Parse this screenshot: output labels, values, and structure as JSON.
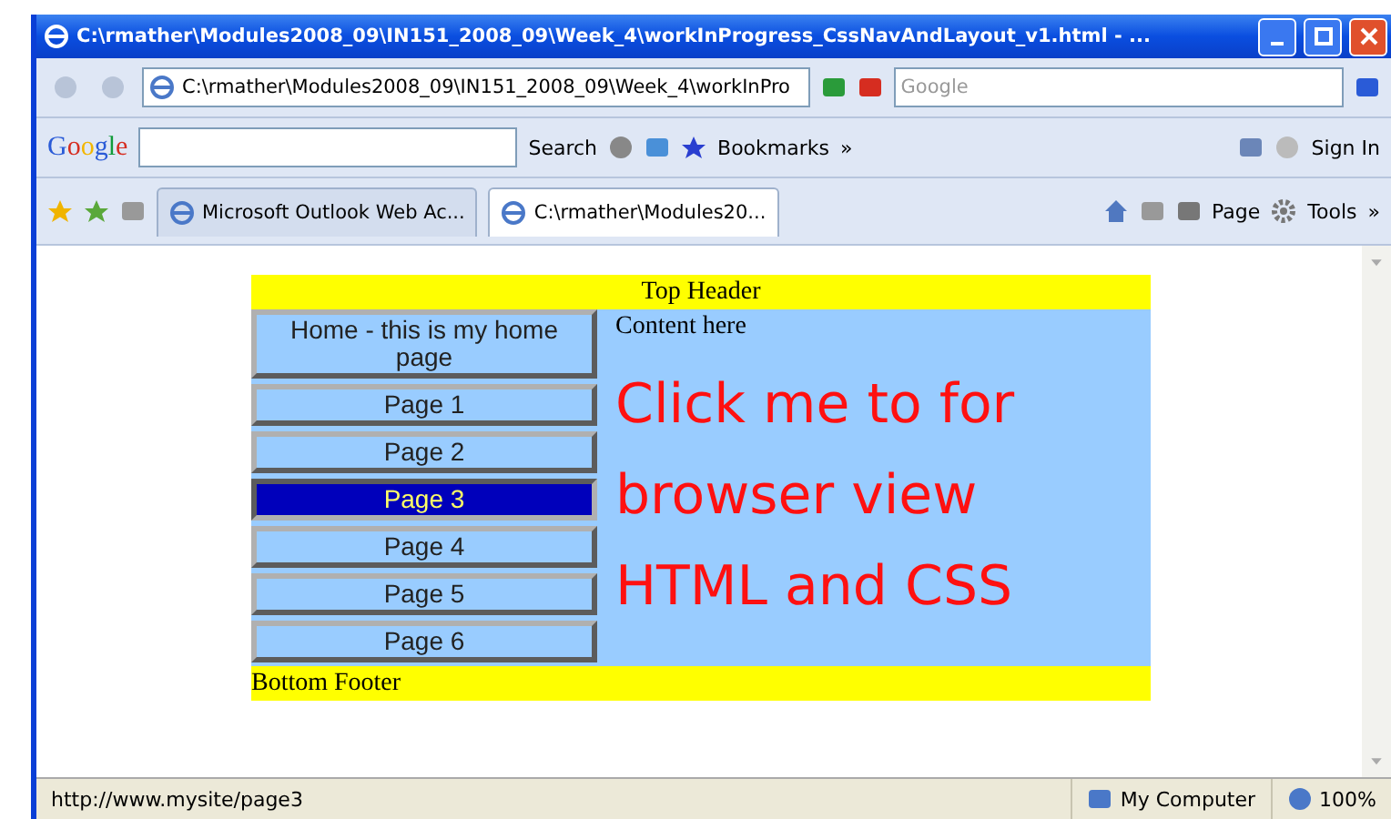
{
  "window": {
    "title": "C:\\rmather\\Modules2008_09\\IN151_2008_09\\Week_4\\workInProgress_CssNavAndLayout_v1.html - ..."
  },
  "address_bar": {
    "url": "C:\\rmather\\Modules2008_09\\IN151_2008_09\\Week_4\\workInPro",
    "search_placeholder": "Google"
  },
  "google_toolbar": {
    "logo": "Google",
    "search_label": "Search",
    "bookmarks": "Bookmarks",
    "overflow": "»",
    "sign_in": "Sign In"
  },
  "tabs": [
    {
      "label": "Microsoft Outlook Web Ac...",
      "selected": false
    },
    {
      "label": "C:\\rmather\\Modules20...",
      "selected": true
    }
  ],
  "command_bar": {
    "page": "Page",
    "tools": "Tools",
    "overflow": "»"
  },
  "page": {
    "header": "Top Header",
    "content_label": "Content here",
    "nav": [
      {
        "label": "Home - this is my home page",
        "selected": false
      },
      {
        "label": "Page 1",
        "selected": false
      },
      {
        "label": "Page 2",
        "selected": false
      },
      {
        "label": "Page 3",
        "selected": true
      },
      {
        "label": "Page 4",
        "selected": false
      },
      {
        "label": "Page 5",
        "selected": false
      },
      {
        "label": "Page 6",
        "selected": false
      }
    ],
    "big_text": [
      "Click me to for",
      "browser view",
      "HTML and CSS"
    ],
    "footer": "Bottom Footer"
  },
  "status_bar": {
    "url": "http://www.mysite/page3",
    "zone": "My Computer",
    "zoom": "100%"
  }
}
